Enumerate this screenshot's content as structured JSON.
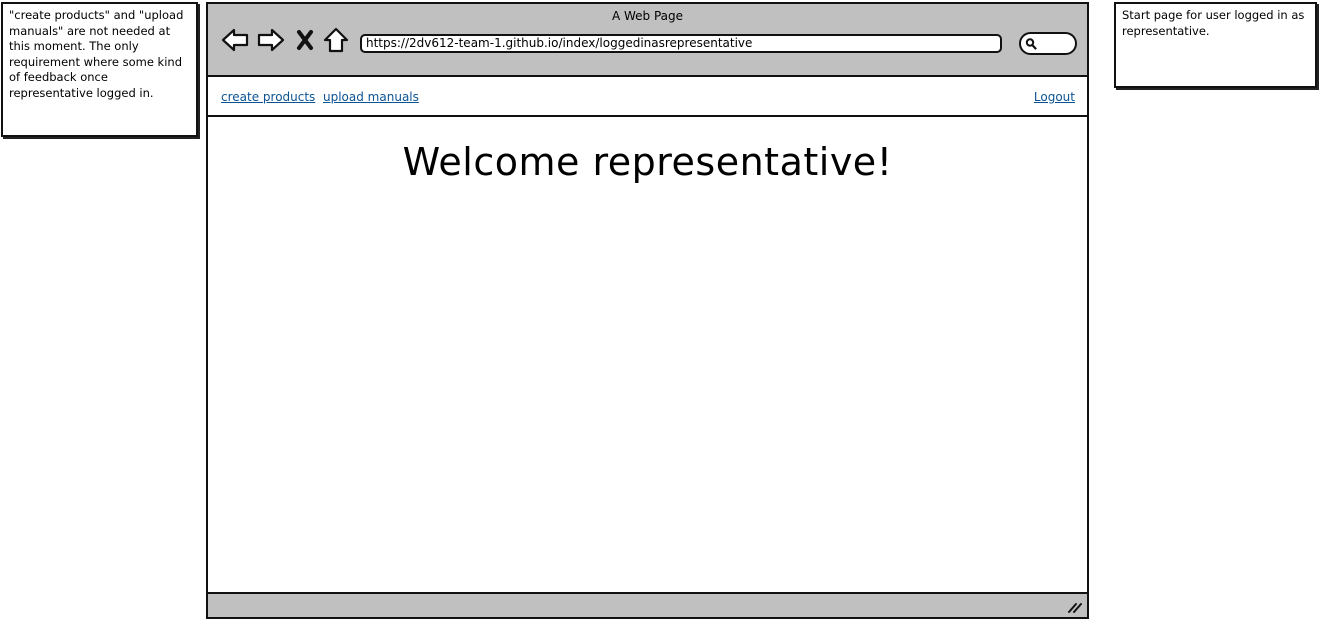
{
  "notes": {
    "left": "\"create products\" and \"upload manuals\" are not needed at this moment. The only requirement where some kind of feedback once representative logged in.",
    "right": "Start page for user logged in as representative."
  },
  "browser": {
    "title": "A Web Page",
    "url": "https://2dv612-team-1.github.io/index/loggedinasrepresentative",
    "icons": [
      "back-arrow-icon",
      "forward-arrow-icon",
      "stop-icon",
      "home-icon",
      "search-icon",
      "resize-grip-icon"
    ]
  },
  "nav": {
    "create_products": "create products",
    "upload_manuals": "upload manuals",
    "logout": "Logout"
  },
  "content": {
    "heading": "Welcome representative!"
  },
  "colors": {
    "chrome_gray": "#c0c0c0",
    "link_blue": "#0b5394"
  }
}
